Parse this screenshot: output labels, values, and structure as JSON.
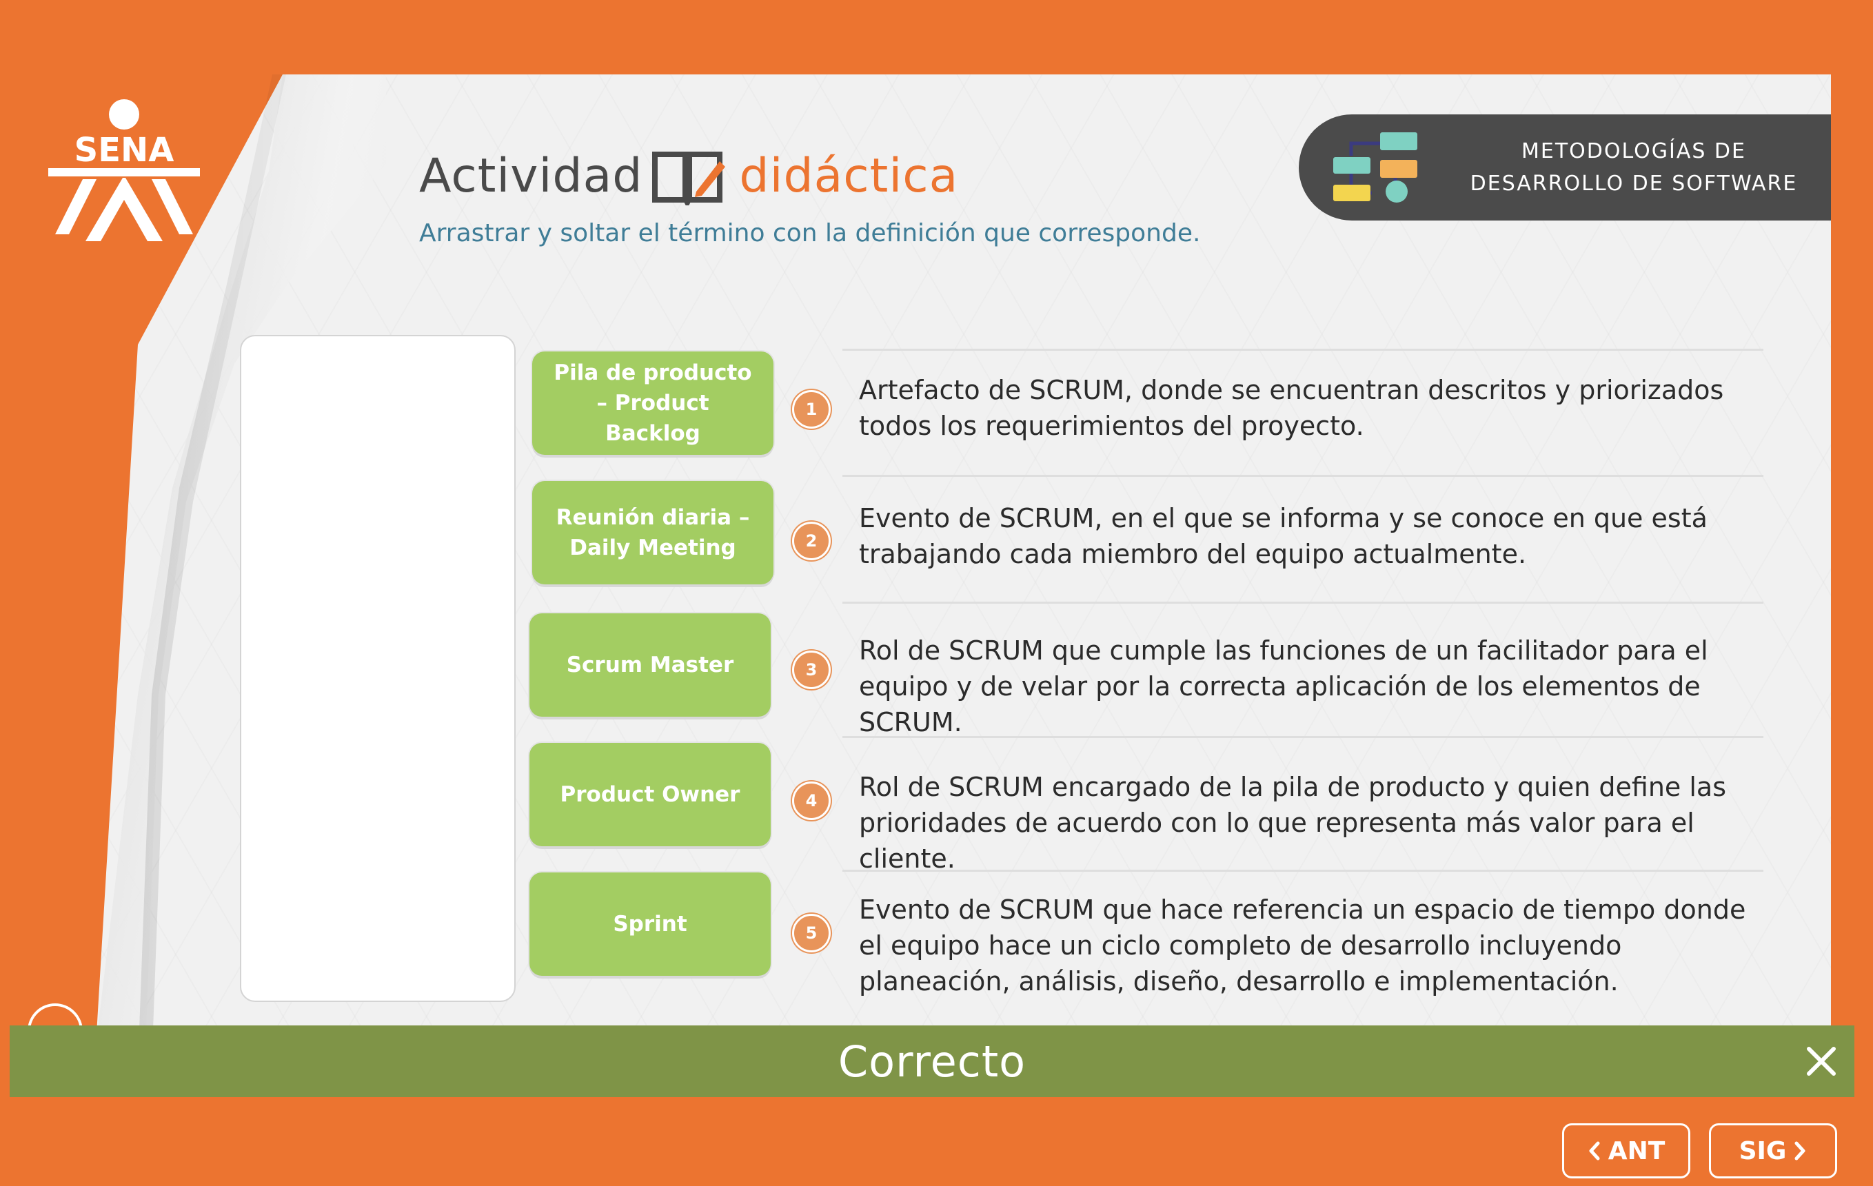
{
  "logo": {
    "text": "SENA"
  },
  "header": {
    "title_part1": "Actividad",
    "title_part2": "didáctica",
    "subtitle": "Arrastrar y soltar el término con la definición que corresponde."
  },
  "badge": {
    "line1": "METODOLOGÍAS DE",
    "line2": "DESARROLLO DE SOFTWARE"
  },
  "terms": [
    {
      "label": "Pila de producto – Product Backlog"
    },
    {
      "label": "Reunión diaria – Daily Meeting"
    },
    {
      "label": "Scrum Master"
    },
    {
      "label": "Product Owner"
    },
    {
      "label": "Sprint"
    }
  ],
  "definitions": [
    {
      "number": "1",
      "text": "Artefacto de SCRUM, donde se encuentran descritos y priorizados todos los requerimientos del proyecto."
    },
    {
      "number": "2",
      "text": "Evento de SCRUM, en el que se informa y se conoce en que está trabajando cada miembro del equipo actualmente."
    },
    {
      "number": "3",
      "text": "Rol de SCRUM que cumple las funciones de un facilitador para el equipo y de velar por la correcta aplicación de los elementos de SCRUM."
    },
    {
      "number": "4",
      "text": "Rol de SCRUM encargado de la pila de producto y quien define las prioridades de acuerdo con lo que representa más valor para el cliente."
    },
    {
      "number": "5",
      "text": "Evento de SCRUM que hace referencia un espacio de tiempo donde el equipo hace un ciclo completo de desarrollo incluyendo planeación, análisis, diseño, desarrollo e implementación."
    }
  ],
  "feedback": {
    "text": "Correcto"
  },
  "navigation": {
    "prev_label": "ANT",
    "next_label": "SIG"
  },
  "colors": {
    "brand_orange": "#ec7430",
    "term_green": "#a3cd62",
    "feedback_green": "#7f9447",
    "badge_gray": "#4b4b4b",
    "subtitle_blue": "#3f7d97"
  }
}
